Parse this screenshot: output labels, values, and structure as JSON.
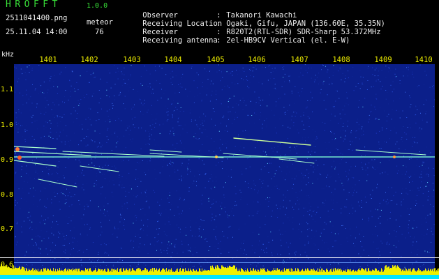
{
  "app": {
    "name": "HROFFT",
    "version": "1.0.0"
  },
  "file_name": "2511041400.png",
  "timestamp": "25.11.04 14:00",
  "detection": {
    "label": "meteor",
    "count": "76"
  },
  "info": [
    {
      "label": "Observer",
      "value": "Takanori Kawachi"
    },
    {
      "label": "Receiving Location",
      "value": "Ogaki, Gifu, JAPAN (136.60E, 35.35N)"
    },
    {
      "label": "Receiver",
      "value": "R820T2(RTL-SDR) SDR-Sharp 53.372MHz"
    },
    {
      "label": "Receiving antenna",
      "value": "2el-HB9CV Vertical (el. E-W)"
    }
  ],
  "y_unit": "kHz",
  "x_ticks": [
    "1401",
    "1402",
    "1403",
    "1404",
    "1405",
    "1406",
    "1407",
    "1408",
    "1409",
    "1410"
  ],
  "y_ticks": [
    "1.1",
    "1.0",
    "0.9",
    "0.8",
    "0.7",
    "0.6"
  ],
  "colors": {
    "background": "#000000",
    "label_green": "#38e038",
    "label_white": "#f0f0f0",
    "tick_yellow": "#f0f000",
    "spectrogram_bg": "#0b1f8a",
    "signal": "#7fffd4",
    "bar_yellow": "#f0f000",
    "bar_cyan": "#00e5ff"
  }
}
